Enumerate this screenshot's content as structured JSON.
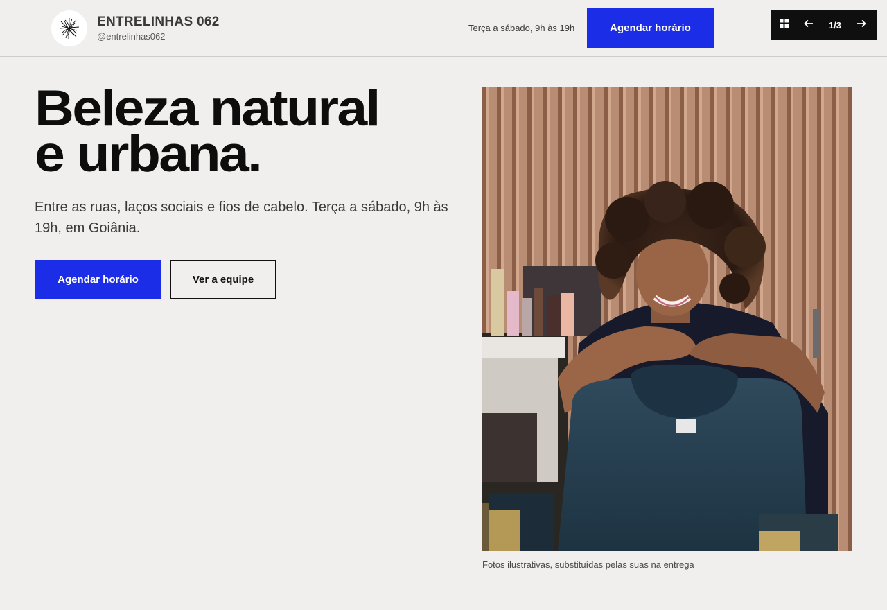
{
  "header": {
    "brand_name": "ENTRELINHAS 062",
    "brand_handle": "@entrelinhas062",
    "hours": "Terça a sábado, 9h às 19h",
    "cta_label": "Agendar horário",
    "slide_counter": "1/3"
  },
  "hero": {
    "title_line1": "Beleza natural",
    "title_line2": "e urbana.",
    "subtitle": "Entre as ruas, laços sociais e fios de cabelo. Terça a sábado, 9h às 19h, em Goiânia.",
    "primary_label": "Agendar horário",
    "secondary_label": "Ver a equipe"
  },
  "photo": {
    "caption": "Fotos ilustrativas, substituídas pelas suas na entrega"
  },
  "colors": {
    "accent": "#1b2de6",
    "background": "#f1efed",
    "dark": "#0f0f0f"
  },
  "icons": [
    "logo-icon",
    "grid-icon",
    "arrow-left-icon",
    "arrow-right-icon"
  ]
}
